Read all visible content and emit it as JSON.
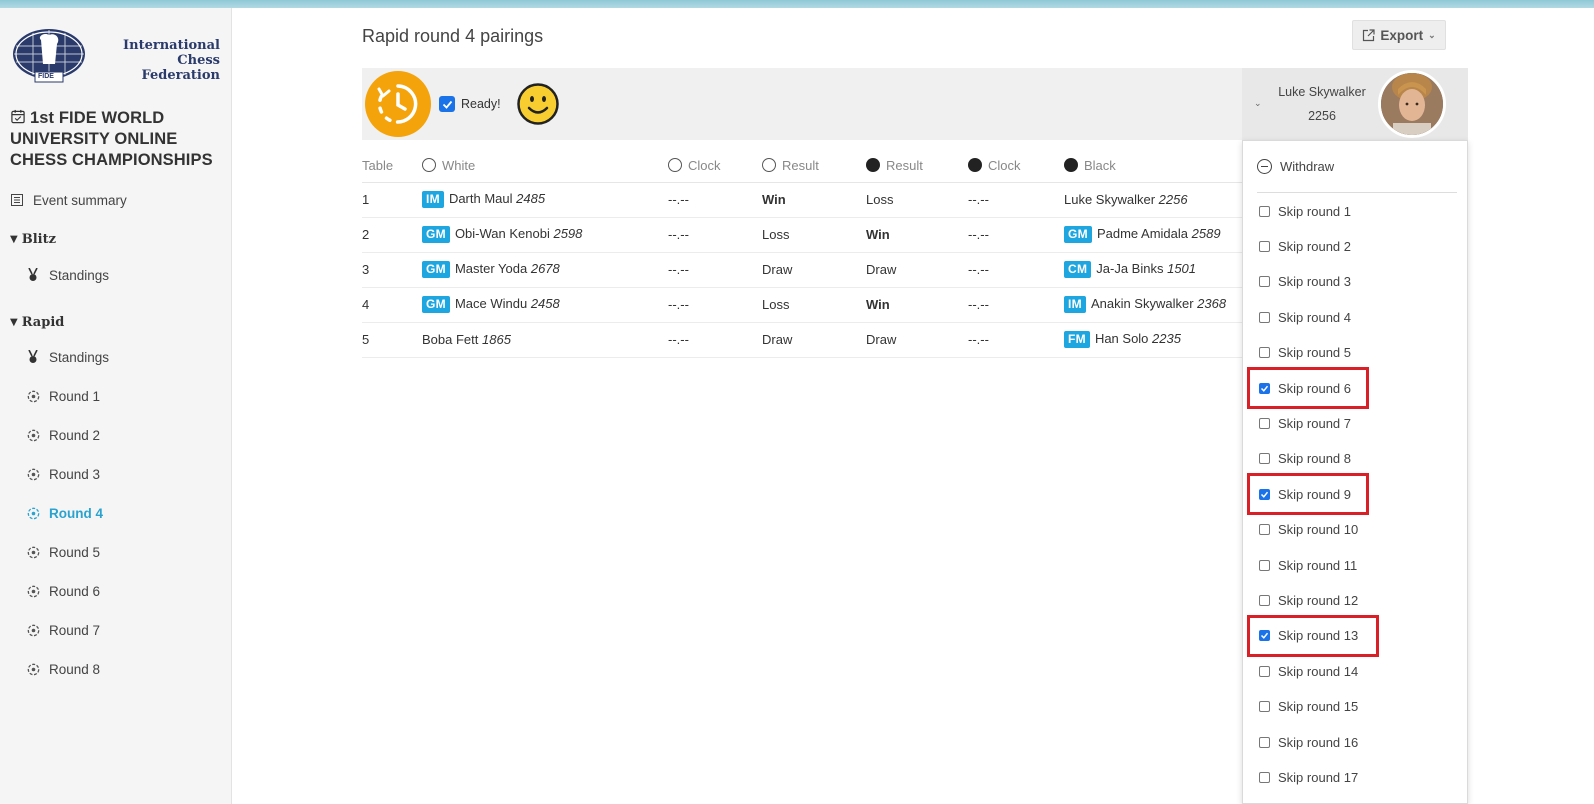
{
  "sidebar": {
    "logo_text": "International\nChess Federation",
    "logo_badge": "FIDE",
    "event_title": "1st FIDE WORLD UNIVERSITY ONLINE CHESS CHAMPIONSHIPS",
    "event_summary": "Event summary",
    "blitz_section": "Blitz",
    "blitz_standings": "Standings",
    "rapid_section": "Rapid",
    "rapid_standings": "Standings",
    "rounds": [
      "Round 1",
      "Round 2",
      "Round 3",
      "Round 4",
      "Round 5",
      "Round 6",
      "Round 7",
      "Round 8"
    ],
    "active_round": "Round 4"
  },
  "header": {
    "title": "Rapid round 4 pairings",
    "export_label": "Export"
  },
  "player_bar": {
    "ready_label": "Ready!",
    "ready_checked": true
  },
  "table": {
    "headers": {
      "table": "Table",
      "white": "White",
      "white_clock": "Clock",
      "white_result": "Result",
      "black_result": "Result",
      "black_clock": "Clock",
      "black": "Black"
    },
    "rows": [
      {
        "table": "1",
        "white_title": "IM",
        "white_name": "Darth Maul",
        "white_rating": "2485",
        "white_clock": "--.--",
        "white_result": "Win",
        "white_result_bold": true,
        "black_result": "Loss",
        "black_result_bold": false,
        "black_clock": "--.--",
        "black_title": "",
        "black_name": "Luke Skywalker",
        "black_rating": "2256"
      },
      {
        "table": "2",
        "white_title": "GM",
        "white_name": "Obi-Wan Kenobi",
        "white_rating": "2598",
        "white_clock": "--.--",
        "white_result": "Loss",
        "white_result_bold": false,
        "black_result": "Win",
        "black_result_bold": true,
        "black_clock": "--.--",
        "black_title": "GM",
        "black_name": "Padme Amidala",
        "black_rating": "2589"
      },
      {
        "table": "3",
        "white_title": "GM",
        "white_name": "Master Yoda",
        "white_rating": "2678",
        "white_clock": "--.--",
        "white_result": "Draw",
        "white_result_bold": false,
        "black_result": "Draw",
        "black_result_bold": false,
        "black_clock": "--.--",
        "black_title": "CM",
        "black_name": "Ja-Ja Binks",
        "black_rating": "1501"
      },
      {
        "table": "4",
        "white_title": "GM",
        "white_name": "Mace Windu",
        "white_rating": "2458",
        "white_clock": "--.--",
        "white_result": "Loss",
        "white_result_bold": false,
        "black_result": "Win",
        "black_result_bold": true,
        "black_clock": "--.--",
        "black_title": "IM",
        "black_name": "Anakin Skywalker",
        "black_rating": "2368"
      },
      {
        "table": "5",
        "white_title": "",
        "white_name": "Boba Fett",
        "white_rating": "1865",
        "white_clock": "--.--",
        "white_result": "Draw",
        "white_result_bold": false,
        "black_result": "Draw",
        "black_result_bold": false,
        "black_clock": "--.--",
        "black_title": "FM",
        "black_name": "Han Solo",
        "black_rating": "2235"
      }
    ]
  },
  "player_menu": {
    "name": "Luke Skywalker",
    "rating": "2256",
    "withdraw_label": "Withdraw",
    "skip_rounds": [
      {
        "label": "Skip round 1",
        "checked": false
      },
      {
        "label": "Skip round 2",
        "checked": false
      },
      {
        "label": "Skip round 3",
        "checked": false
      },
      {
        "label": "Skip round 4",
        "checked": false
      },
      {
        "label": "Skip round 5",
        "checked": false
      },
      {
        "label": "Skip round 6",
        "checked": true
      },
      {
        "label": "Skip round 7",
        "checked": false
      },
      {
        "label": "Skip round 8",
        "checked": false
      },
      {
        "label": "Skip round 9",
        "checked": true
      },
      {
        "label": "Skip round 10",
        "checked": false
      },
      {
        "label": "Skip round 11",
        "checked": false
      },
      {
        "label": "Skip round 12",
        "checked": false
      },
      {
        "label": "Skip round 13",
        "checked": true
      },
      {
        "label": "Skip round 14",
        "checked": false
      },
      {
        "label": "Skip round 15",
        "checked": false
      },
      {
        "label": "Skip round 16",
        "checked": false
      },
      {
        "label": "Skip round 17",
        "checked": false
      }
    ]
  },
  "colors": {
    "accent": "#2aa3cf",
    "badge": "#1ea6e0",
    "clock_orange": "#f5a30a",
    "checkbox_blue": "#1a73e8",
    "highlight_red": "#d92027"
  }
}
